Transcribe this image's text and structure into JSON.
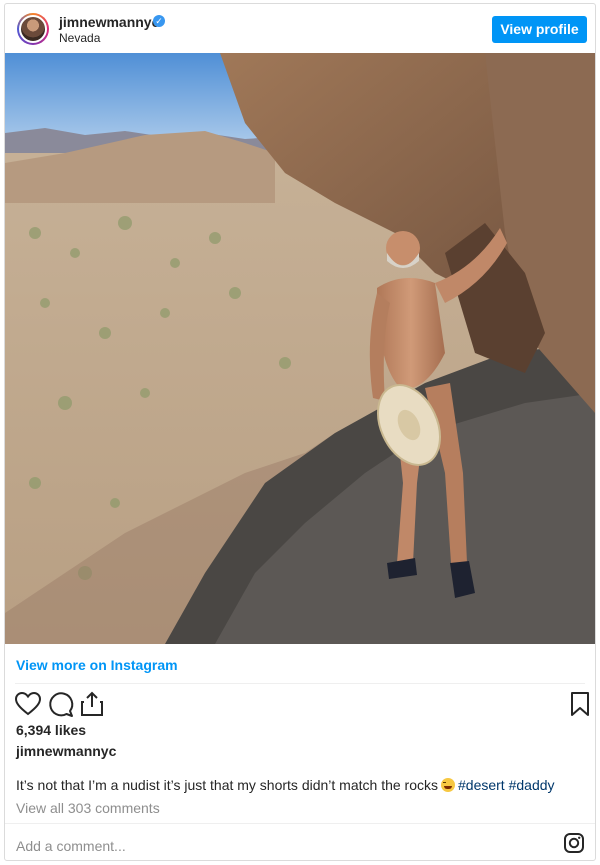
{
  "post": {
    "username": "jimnewmannyc",
    "verified_badge": "✓",
    "location": "Nevada",
    "view_profile_label": "View profile",
    "view_more_label": "View more on Instagram",
    "likes": "6,394 likes",
    "caption_user": "jimnewmannyc",
    "caption_text": "It’s not that I’m a nudist it’s just that my shorts didn’t match the rocks",
    "hashtags": [
      "#desert",
      "#daddy"
    ],
    "view_comments_label": "View all 303 comments",
    "add_comment_placeholder": "Add a comment...",
    "icons": [
      "heart-icon",
      "comment-icon",
      "share-icon",
      "bookmark-icon",
      "instagram-logo-icon"
    ]
  },
  "colors": {
    "accent": "#0095f6",
    "hashtag": "#00376b",
    "muted": "#8e8e8e",
    "text": "#262626",
    "border": "#dbdbdb"
  }
}
